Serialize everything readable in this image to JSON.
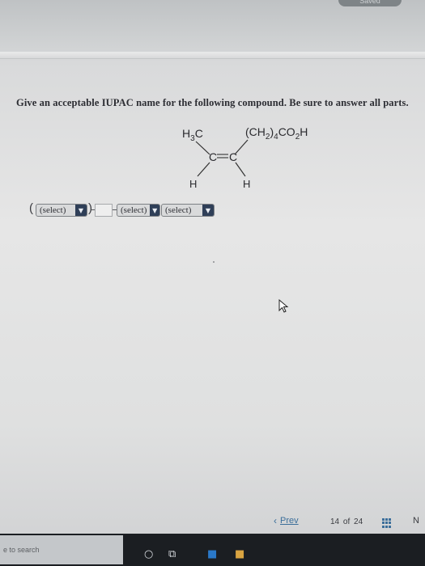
{
  "header": {
    "top_button_label": "Saved"
  },
  "question": {
    "text": "Give an acceptable IUPAC name for the following compound. Be sure to answer all parts."
  },
  "structure": {
    "left_top": "H3C",
    "right_top": "(CH2)4CO2H",
    "left_bottom": "H",
    "right_bottom": "H",
    "alkene": "C=C"
  },
  "answer": {
    "open_paren": "(",
    "close_paren": ")",
    "select1": {
      "label": "(select)"
    },
    "select2": {
      "label": "(select)"
    },
    "select3": {
      "label": "(select)"
    },
    "textbox_value": ""
  },
  "nav": {
    "prev_label": "Prev",
    "page_current": "14",
    "page_of": "of",
    "page_total": "24",
    "next_label": "N"
  },
  "taskbar": {
    "search_text": "e to search"
  },
  "colors": {
    "select_arrow_bg": "#2f3f58",
    "link": "#3b6e9a",
    "taskbar": "#1b1e22"
  }
}
